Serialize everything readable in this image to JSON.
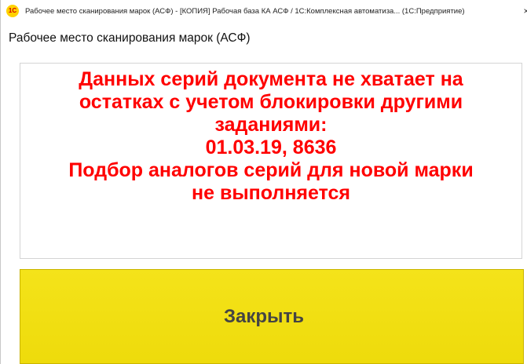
{
  "window": {
    "title": "Рабочее место сканирования марок (АСФ) - [КОПИЯ] Рабочая база КА АСФ / 1С:Комплексная автоматиза... (1С:Предприятие)",
    "app_icon_text": "1С",
    "close_glyph": "×"
  },
  "form": {
    "title": "Рабочее место сканирования марок (АСФ)"
  },
  "message": {
    "lines": [
      "Данных серий документа не хватает на",
      "остатках с учетом блокировки другими",
      "заданиями:",
      "01.03.19, 8636",
      "Подбор аналогов серий для новой марки",
      "не выполняется"
    ],
    "color": "#ff0000"
  },
  "close_button": {
    "label": "Закрыть",
    "color": "#f0df10"
  }
}
